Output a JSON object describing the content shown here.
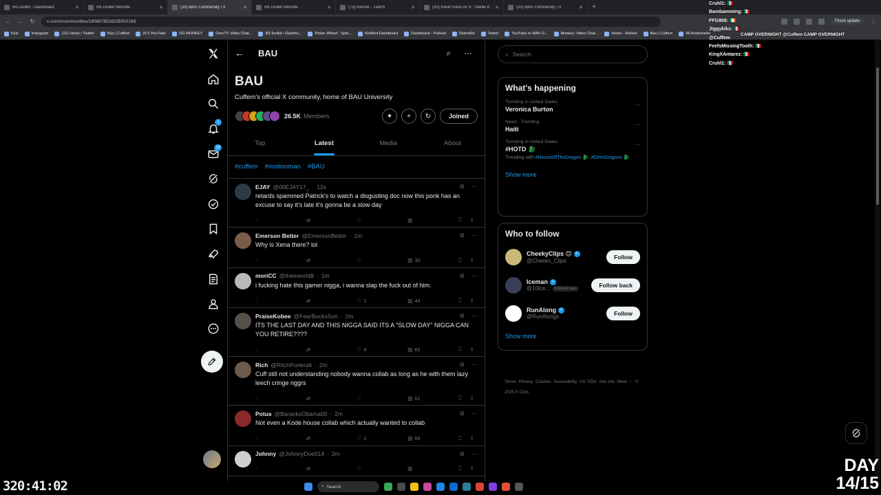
{
  "browser": {
    "tabs": [
      {
        "label": "IRLToolkit - Dashboard",
        "active": false
      },
      {
        "label": "IRLToolkit Remote",
        "active": false
      },
      {
        "label": "(20) BAU Community / X",
        "active": true
      },
      {
        "label": "IRLToolkit Remote",
        "active": false
      },
      {
        "label": "(73) AshAlk - Twitch",
        "active": false
      },
      {
        "label": "(20) Kevin Kans on X: \"Derek K",
        "active": false
      },
      {
        "label": "(20) BAU Community / X",
        "active": false
      }
    ],
    "url": "x.com/i/communities/1908678516235002169",
    "finish_update": "Finish update",
    "bookmarks": [
      "Kick",
      "Instagram",
      "(12) Home / Twitter",
      "Bau | Cuffem",
      "(57) YouTube",
      "OG MONKEY",
      "OmeTV Video Chat...",
      "IRLToolkit • Dashbo...",
      "Picker Wheel - Spin...",
      "KickBot Dashboard",
      "Dashboard - Pulsoid",
      "DistroKid",
      "Twitch",
      "YouTube to WAV D...",
      "Monkey: Video Chat...",
      "Home - Roblox",
      "Bau | Cuffem",
      "All Bookmarks"
    ]
  },
  "chat_overlay": {
    "lines": [
      "Cruhl1: 🇲🇽",
      "Bambamming: 🇲🇽",
      "FFG909: 🇮🇪",
      "Jiggykiks: 🇲🇽",
      "FeefsMissingTooth: 🇲🇽",
      "KingXAntarez: 🇲🇽",
      "Cruhl1: 🇲🇽"
    ],
    "mention": "@Cuffem",
    "camp": "CAMP OVERNIGHT @Cuffem   CAMP OVERNIGHT"
  },
  "nav": {
    "notifications_badge": "1",
    "messages_badge": "19"
  },
  "community": {
    "header_title": "BAU",
    "name": "BAU",
    "description": "Cuffem's official X community, home of BAU University",
    "member_count": "26.5K",
    "member_label": "Members",
    "joined_label": "Joined",
    "tabs": [
      "Top",
      "Latest",
      "Media",
      "About"
    ],
    "active_tab": "Latest",
    "hashtags": [
      "#cuffem",
      "#motionman",
      "#BAU"
    ]
  },
  "tweets": [
    {
      "name": "EJAY",
      "handle": "@00EJAY17_",
      "time": "12s",
      "text": "retards spammed Patrick's to watch a disgusting doc now this ponk has an excuse to say it's late it's gonna be a slow day",
      "replies": "",
      "retweets": "",
      "likes": "",
      "views": "",
      "avatar": "#2e3a44"
    },
    {
      "name": "Emerson Better",
      "handle": "@EmersonBetter",
      "time": "1m",
      "text": "Why is Xena there? lol",
      "replies": "",
      "retweets": "",
      "likes": "",
      "views": "30",
      "avatar": "#7a5c4a"
    },
    {
      "name": "moriCC",
      "handle": "@theeworld8",
      "time": "1m",
      "text": "i fucking hate this gamer nigga, i wanna slap the fuck out of him.",
      "replies": "",
      "retweets": "",
      "likes": "1",
      "views": "44",
      "avatar": "#b8b8b8"
    },
    {
      "name": "PraiseKobee",
      "handle": "@FearBucksSon",
      "time": "2m",
      "text": "ITS THE LAST DAY AND THIS NIGGA SAID ITS A \"SLOW DAY\" NIGGA CAN YOU RETIRE????",
      "replies": "",
      "retweets": "",
      "likes": "4",
      "views": "65",
      "avatar": "#55504a"
    },
    {
      "name": "Rich",
      "handle": "@RiichPorteralt",
      "time": "2m",
      "text": "Cuff still not understanding nobody wanna collab as long as he with them lazy leech cringe nggrs",
      "replies": "",
      "retweets": "",
      "likes": "",
      "views": "61",
      "avatar": "#6e5a4c"
    },
    {
      "name": "Potus",
      "handle": "@BaracksObama00",
      "time": "2m",
      "text": "Not even a Kode house collab which actually wanted to collab",
      "replies": "",
      "retweets": "",
      "likes": "1",
      "views": "66",
      "avatar": "#8a2a2a"
    },
    {
      "name": "Johnny",
      "handle": "@JohnnyDoe014",
      "time": "2m",
      "text": "",
      "replies": "",
      "retweets": "",
      "likes": "",
      "views": "",
      "avatar": "#cfcfcf"
    }
  ],
  "sidebar": {
    "search_placeholder": "Search",
    "whats_happening_title": "What's happening",
    "trends": [
      {
        "context": "Trending in United States",
        "name": "Veronica Burton",
        "with": ""
      },
      {
        "context": "News · Trending",
        "name": "Haiti",
        "with": ""
      },
      {
        "context": "Trending in United States",
        "name": "#HOTD 🐉",
        "with_prefix": "Trending with",
        "with_tags": [
          "#HouseOfTheDragon 🐉",
          "#DemDragons 🐉"
        ]
      }
    ],
    "show_more": "Show more",
    "who_to_follow_title": "Who to follow",
    "follow_suggestions": [
      {
        "name": "CheekyClips 😊",
        "handle": "@Cheeks_Clips",
        "follows_you": "",
        "button": "Follow",
        "avatar": "#c9b87a"
      },
      {
        "name": "Iceman",
        "handle": "@10ice...",
        "follows_you": "Follows you",
        "button": "Follow back",
        "avatar": "#3a3f55"
      },
      {
        "name": "RunAlong",
        "handle": "@RunAlongs",
        "follows_you": "",
        "button": "Follow",
        "avatar": "#ffffff"
      }
    ],
    "footer": [
      "Terms",
      "Privacy",
      "Cookies",
      "Accessibility",
      "US TIDA",
      "Ads info",
      "More ···",
      "© 2025 X Corp."
    ]
  },
  "stream": {
    "timer": "320:41:02",
    "day_line1": "DAY",
    "day_line2": "14/15"
  },
  "taskbar": {
    "search_label": "Search"
  }
}
